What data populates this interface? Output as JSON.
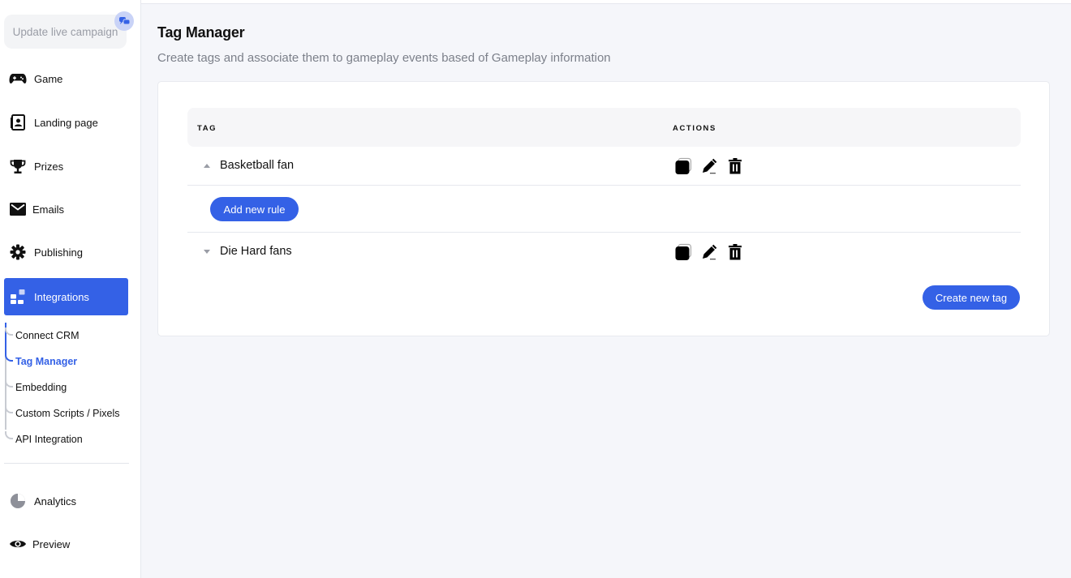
{
  "sidebar": {
    "update_button": "Update live campaign",
    "nav": [
      {
        "id": "game",
        "label": "Game",
        "icon": "gamepad-icon"
      },
      {
        "id": "landing",
        "label": "Landing page",
        "icon": "landing-page-icon"
      },
      {
        "id": "prizes",
        "label": "Prizes",
        "icon": "trophy-icon"
      },
      {
        "id": "emails",
        "label": "Emails",
        "icon": "envelope-icon"
      },
      {
        "id": "publishing",
        "label": "Publishing",
        "icon": "gear-icon"
      },
      {
        "id": "integrations",
        "label": "Integrations",
        "icon": "integrations-icon",
        "active": true
      }
    ],
    "subnav": [
      {
        "label": "Connect CRM"
      },
      {
        "label": "Tag Manager",
        "active": true
      },
      {
        "label": "Embedding"
      },
      {
        "label": "Custom Scripts / Pixels"
      },
      {
        "label": "API Integration"
      }
    ],
    "bottom_nav": [
      {
        "label": "Analytics",
        "icon": "pie-chart-icon"
      },
      {
        "label": "Preview",
        "icon": "eye-icon"
      }
    ]
  },
  "page": {
    "title": "Tag Manager",
    "subtitle": "Create tags and associate them to gameplay events based of Gameplay information"
  },
  "table": {
    "columns": {
      "tag": "TAG",
      "actions": "ACTIONS"
    },
    "rows": [
      {
        "name": "Basketball fan",
        "expanded": true
      },
      {
        "name": "Die Hard fans",
        "expanded": false
      }
    ],
    "add_rule_label": "Add new rule",
    "create_tag_label": "Create new tag"
  },
  "colors": {
    "accent": "#3461e6",
    "muted": "#7c808a"
  }
}
